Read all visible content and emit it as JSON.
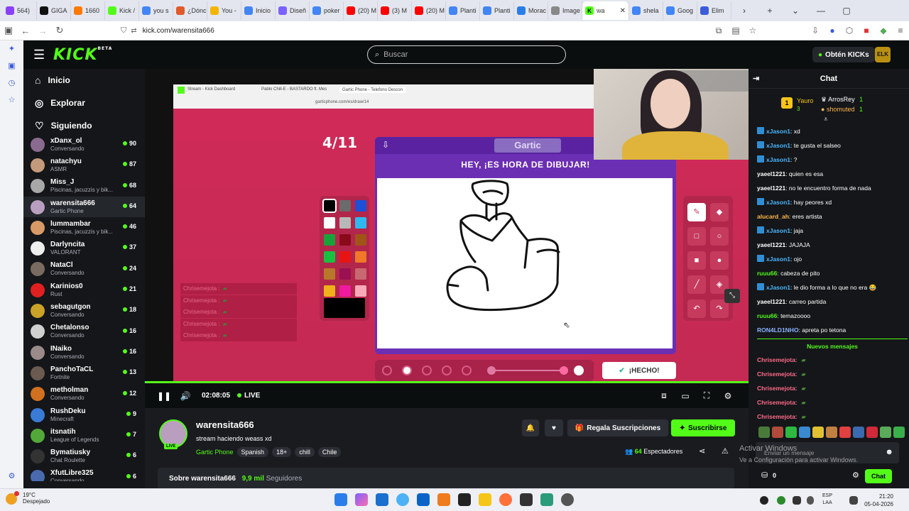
{
  "browser": {
    "tabs": [
      {
        "label": "564)",
        "color": "#8a3ffc"
      },
      {
        "label": "GIGA",
        "color": "#111111"
      },
      {
        "label": "1660",
        "color": "#ff7a00"
      },
      {
        "label": "Kick /",
        "color": "#53fc18"
      },
      {
        "label": "you s",
        "color": "#4285f4"
      },
      {
        "label": "¿Dónc",
        "color": "#e05a2a"
      },
      {
        "label": "You -",
        "color": "#f4b400"
      },
      {
        "label": "Inicio",
        "color": "#4285f4"
      },
      {
        "label": "Diseñ",
        "color": "#7b61ff"
      },
      {
        "label": "poker",
        "color": "#4285f4"
      },
      {
        "label": "(20) M",
        "color": "#ff0000"
      },
      {
        "label": "(3) M",
        "color": "#ff0000"
      },
      {
        "label": "(20) M",
        "color": "#ff0000"
      },
      {
        "label": "Planti",
        "color": "#4285f4"
      },
      {
        "label": "Planti",
        "color": "#4285f4"
      },
      {
        "label": "Morac",
        "color": "#2b7de9"
      },
      {
        "label": "Image",
        "color": "#888888"
      }
    ],
    "active_tab": "wa",
    "tabs_after": [
      {
        "label": "shela",
        "color": "#4285f4"
      },
      {
        "label": "Goog",
        "color": "#4285f4"
      },
      {
        "label": "Elim",
        "color": "#3b5bdb"
      }
    ],
    "url": "kick.com/warensita666"
  },
  "header": {
    "logo": "KICK",
    "logo_beta": "BETA",
    "search_placeholder": "Buscar",
    "get_kicks": "Obtén KICKs",
    "user_avatar": "ELK"
  },
  "sidebar": {
    "nav": [
      {
        "label": "Inicio",
        "icon": "home-icon"
      },
      {
        "label": "Explorar",
        "icon": "compass-icon"
      },
      {
        "label": "Siguiendo",
        "icon": "heart-icon"
      }
    ],
    "channels": [
      {
        "name": "xDanx_ol",
        "category": "Conversando",
        "viewers": "90",
        "color": "#8a6b8f"
      },
      {
        "name": "natachyu",
        "category": "ASMR",
        "viewers": "87",
        "color": "#c49a7c"
      },
      {
        "name": "Miss_J",
        "category": "Piscinas, jacuzzis y bik...",
        "viewers": "68",
        "color": "#a8a8a8"
      },
      {
        "name": "warensita666",
        "category": "Gartic Phone",
        "viewers": "64",
        "color": "#b99ec0"
      },
      {
        "name": "lummambar",
        "category": "Piscinas, jacuzzis y bik...",
        "viewers": "46",
        "color": "#d89a66"
      },
      {
        "name": "Darlyncita",
        "category": "VALORANT",
        "viewers": "37",
        "color": "#eeeeee"
      },
      {
        "name": "NataCl",
        "category": "Conversando",
        "viewers": "24",
        "color": "#7a6b60"
      },
      {
        "name": "Karinios0",
        "category": "Rust",
        "viewers": "21",
        "color": "#e02020"
      },
      {
        "name": "sebagutgon",
        "category": "Conversando",
        "viewers": "18",
        "color": "#c9a227"
      },
      {
        "name": "Chetalonso",
        "category": "Conversando",
        "viewers": "16",
        "color": "#d0d0d0"
      },
      {
        "name": "INaiko",
        "category": "Conversando",
        "viewers": "16",
        "color": "#9b8a8a"
      },
      {
        "name": "PanchoTaCL",
        "category": "Fortnite",
        "viewers": "13",
        "color": "#6b5a50"
      },
      {
        "name": "metholman",
        "category": "Conversando",
        "viewers": "12",
        "color": "#d07020"
      },
      {
        "name": "RushDeku",
        "category": "Minecraft",
        "viewers": "9",
        "color": "#3a7bd5"
      },
      {
        "name": "itsnatih",
        "category": "League of Legends",
        "viewers": "7",
        "color": "#53a83a"
      },
      {
        "name": "Bymatiusky",
        "category": "Chat Roulette",
        "viewers": "6",
        "color": "#333333"
      },
      {
        "name": "XfutLibre325",
        "category": "Conversando",
        "viewers": "6",
        "color": "#4a6ab0"
      }
    ]
  },
  "video": {
    "inner_tabs": [
      "Stream - Kick Dashboard",
      "Pablo Chill-E - BASTARDO ft. Mes",
      "Gartic Phone - Telefono Descon"
    ],
    "inner_url": "garticphone.com/es/draw/14",
    "round": "4/11",
    "gartic_logo": "Gartic",
    "prompt": "HEY, ¡ES HORA DE DIBUJAR!",
    "done_button": "¡HECHO!",
    "overlay_chat": [
      "Chrisemejota :",
      "Chrisemejota :",
      "Chrisemejota :",
      "Chrisemejota :",
      "Chrisemejota :"
    ],
    "time": "02:08:05",
    "live": "LIVE"
  },
  "stream_info": {
    "channel": "warensita666",
    "live_badge": "LIVE",
    "title": "stream haciendo weass xd",
    "category": "Gartic Phone",
    "tags": [
      "Spanish",
      "18+",
      "chill",
      "Chile"
    ],
    "gift_subs": "Regala Suscripciones",
    "subscribe": "Suscribirse",
    "viewers": "64",
    "viewers_label": "Espectadores",
    "about_label": "Sobre warensita666",
    "followers": "9,9 mil",
    "followers_label": "Seguidores"
  },
  "chat": {
    "title": "Chat",
    "leaders": [
      {
        "name": "Yauro",
        "value": "3"
      },
      {
        "name": "ArrosRey",
        "value": "1"
      },
      {
        "name": "shomuted",
        "value": "1"
      }
    ],
    "messages": [
      {
        "user": "xJason1",
        "text": ": xd",
        "color": "#4ab6ff",
        "badge": true
      },
      {
        "user": "xJason1",
        "text": ": te gusta el salseo",
        "color": "#4ab6ff",
        "badge": true
      },
      {
        "user": "xJason1",
        "text": ": ?",
        "color": "#4ab6ff",
        "badge": true
      },
      {
        "user": "yaeel1221",
        "text": ": quien es esa",
        "color": "#ffffff",
        "badge": false
      },
      {
        "user": "yaeel1221",
        "text": ": no le encuentro forma de nada",
        "color": "#ffffff",
        "badge": false
      },
      {
        "user": "xJason1",
        "text": ": hay peores xd",
        "color": "#4ab6ff",
        "badge": true
      },
      {
        "user": "alucard_ah",
        "text": ": eres artista",
        "color": "#ffb74d",
        "badge": false
      },
      {
        "user": "xJason1",
        "text": ": jaja",
        "color": "#4ab6ff",
        "badge": true
      },
      {
        "user": "yaeel1221",
        "text": ": JAJAJA",
        "color": "#ffffff",
        "badge": false
      },
      {
        "user": "xJason1",
        "text": ": ojo",
        "color": "#4ab6ff",
        "badge": true
      },
      {
        "user": "ruuu66",
        "text": ": cabeza de pito",
        "color": "#53fc18",
        "badge": false
      },
      {
        "user": "xJason1",
        "text": ": le dio forma a lo que no era 😂",
        "color": "#4ab6ff",
        "badge": true
      },
      {
        "user": "yaeel1221",
        "text": ": carreo partida",
        "color": "#ffffff",
        "badge": false
      },
      {
        "user": "ruuu66",
        "text": ": temazoooo",
        "color": "#53fc18",
        "badge": false
      },
      {
        "user": "RON4LD1NHO",
        "text": ": apreta po tetona",
        "color": "#8ab4ff",
        "badge": false
      }
    ],
    "new_messages": "Nuevos mensajes",
    "new_msgs": [
      {
        "user": "Chrisemejota",
        "text": ":"
      },
      {
        "user": "Chrisemejota",
        "text": ":"
      },
      {
        "user": "Chrisemejota",
        "text": ":"
      },
      {
        "user": "Chrisemejota",
        "text": ":"
      },
      {
        "user": "Chrisemejota",
        "text": ":"
      }
    ],
    "input_placeholder": "Enviar un mensaje",
    "points": "0",
    "send": "Chat"
  },
  "overlay": {
    "activate_title": "Activar Windows",
    "activate_sub": "Ve a Configuración para activar Windows."
  },
  "taskbar": {
    "temp": "19°C",
    "weather": "Despejado",
    "lang1": "ESP",
    "lang2": "LAA",
    "time": "21:20",
    "date": "05-04-2026"
  }
}
